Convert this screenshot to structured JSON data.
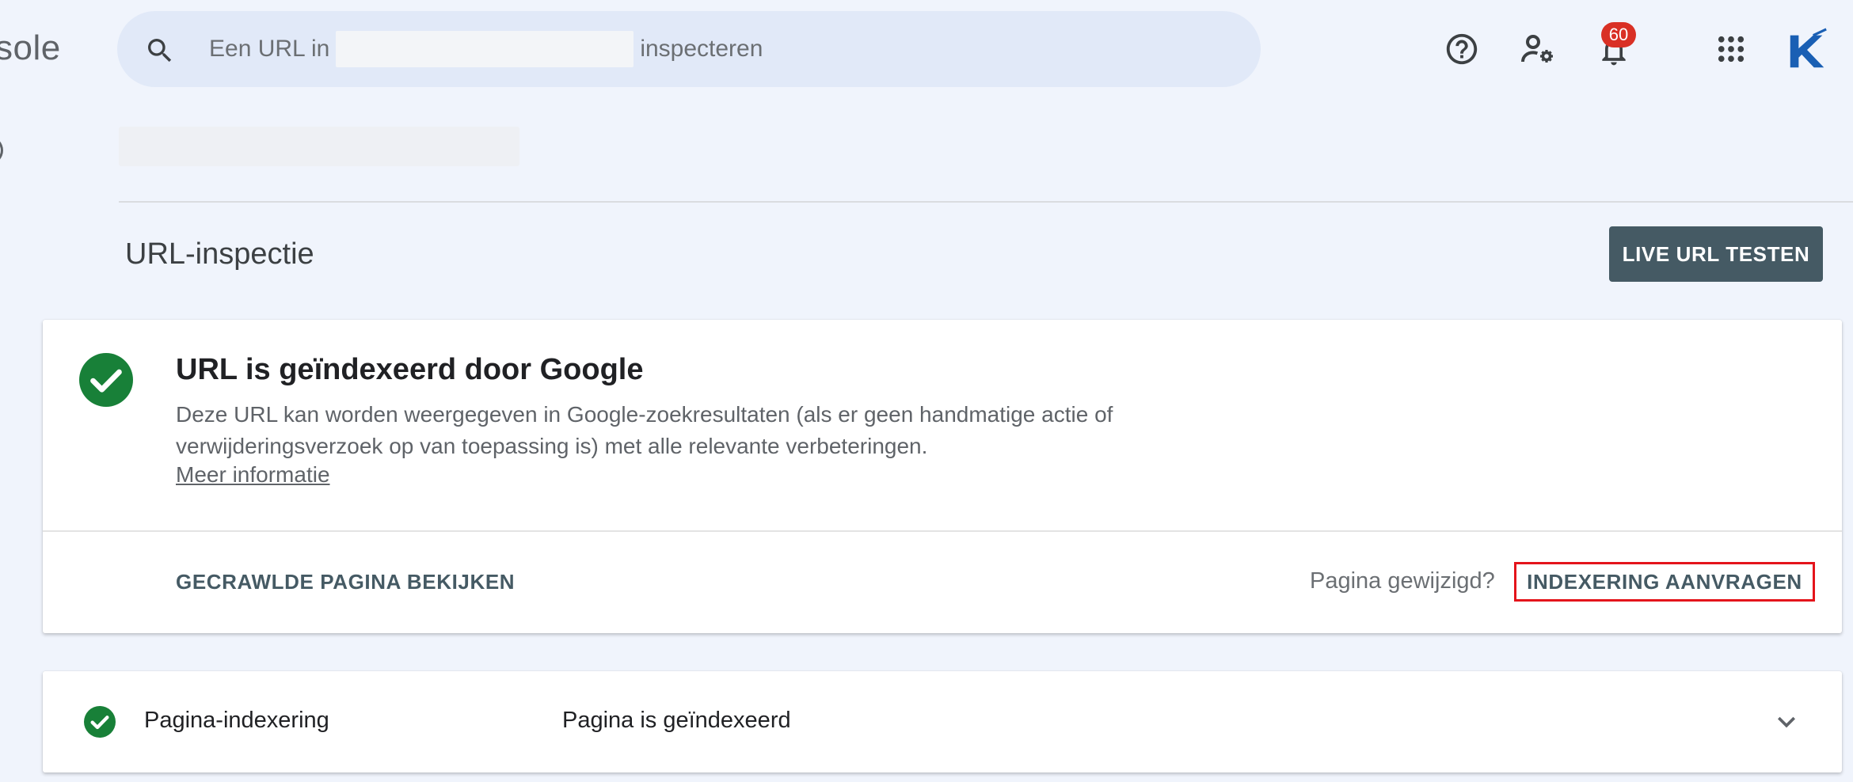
{
  "header": {
    "brand_fragment": "sole",
    "search": {
      "prefix": "Een URL in",
      "suffix": "inspecteren"
    },
    "icons": [
      "search-icon",
      "help-icon",
      "admin-settings-icon",
      "notifications-icon",
      "apps-grid-icon",
      "k-logo-icon"
    ],
    "notification_count": "60"
  },
  "page": {
    "title": "URL-inspectie",
    "live_test_label": "LIVE URL TESTEN"
  },
  "status_card": {
    "title": "URL is geïndexeerd door Google",
    "description": "Deze URL kan worden weergegeven in Google-zoekresultaten (als er geen handmatige actie of verwijderingsverzoek op van toepassing is) met alle relevante verbeteringen.",
    "more_info": "Meer informatie",
    "crawled_page_label": "GECRAWLDE PAGINA BEKIJKEN",
    "page_changed_text": "Pagina gewijzigd?",
    "request_index_label": "INDEXERING AANVRAGEN"
  },
  "indexing_row": {
    "label": "Pagina-indexering",
    "value": "Pagina is geïndexeerd"
  },
  "colors": {
    "success": "#188038",
    "primary_dark": "#455a64",
    "highlight_border": "#e4141b",
    "badge": "#d93025",
    "logo": "#1a5fb4"
  }
}
